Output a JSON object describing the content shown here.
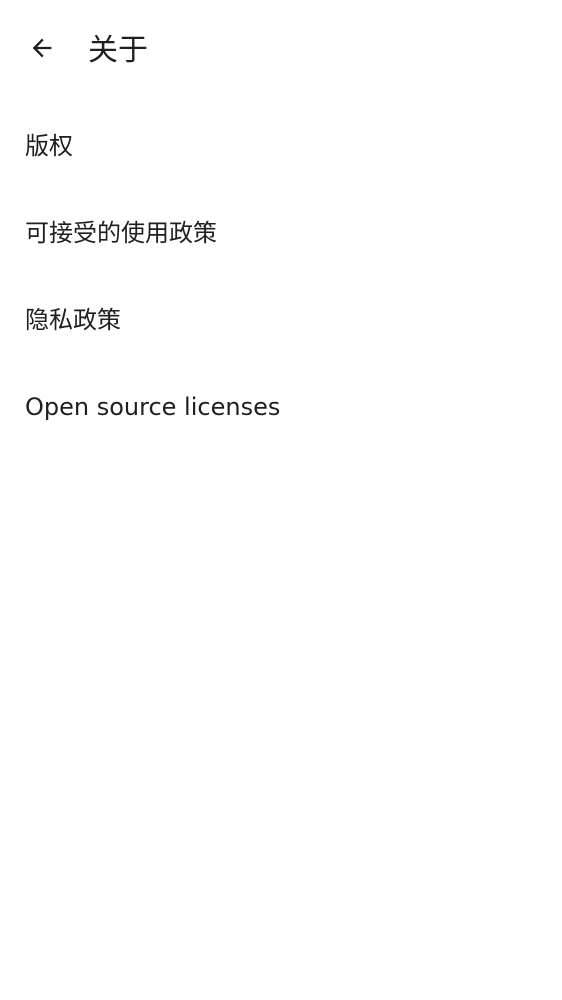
{
  "header": {
    "back_icon": "arrow-back-icon",
    "title": "关于"
  },
  "list": {
    "items": [
      {
        "label": "版权"
      },
      {
        "label": "可接受的使用政策"
      },
      {
        "label": "隐私政策"
      },
      {
        "label": "Open source licenses"
      }
    ]
  },
  "colors": {
    "background": "#ffffff",
    "text": "#1f1f1f"
  }
}
